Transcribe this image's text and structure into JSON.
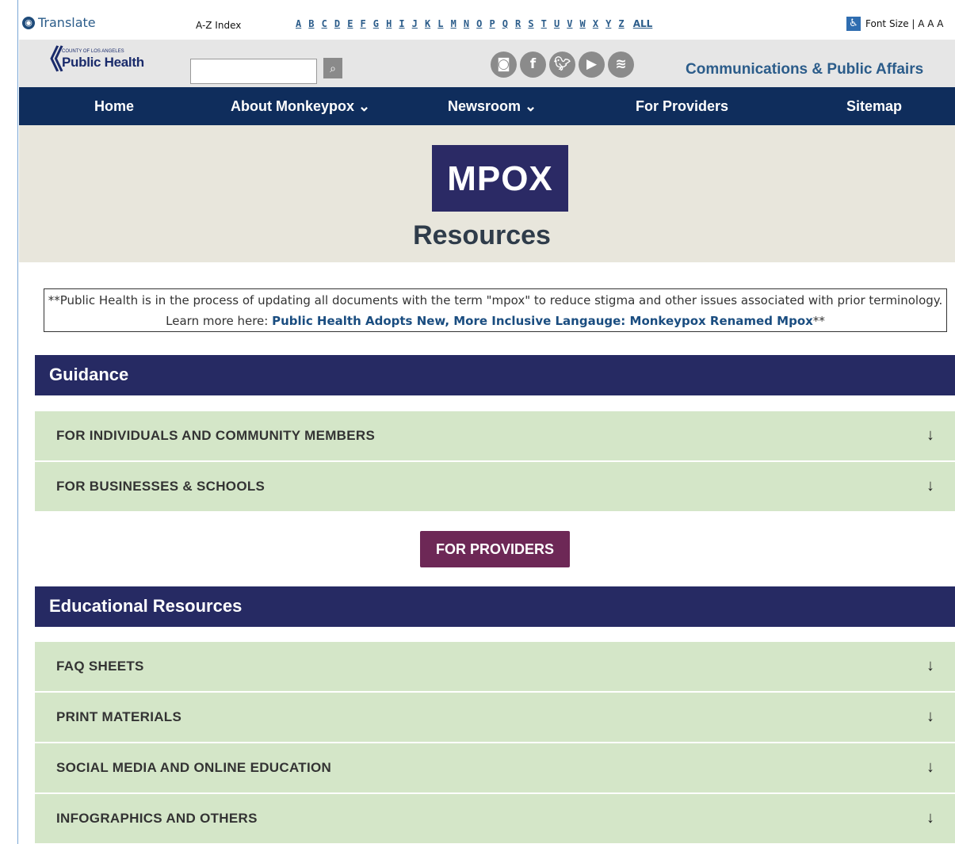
{
  "topbar": {
    "translate": "Translate",
    "az_label": "A-Z Index",
    "letters": [
      "A",
      "B",
      "C",
      "D",
      "E",
      "F",
      "G",
      "H",
      "I",
      "J",
      "K",
      "L",
      "M",
      "N",
      "O",
      "P",
      "Q",
      "R",
      "S",
      "T",
      "U",
      "V",
      "W",
      "X",
      "Y",
      "Z"
    ],
    "all": "ALL",
    "font_size": "Font Size | A A A"
  },
  "header": {
    "logo_small": "COUNTY OF LOS ANGELES",
    "logo_big": "Public Health",
    "search_placeholder": "",
    "social_icons": [
      "instagram-icon",
      "facebook-icon",
      "twitter-icon",
      "youtube-icon",
      "spotify-icon"
    ],
    "dept": "Communications & Public Affairs"
  },
  "nav": {
    "home": "Home",
    "about": "About Monkeypox",
    "newsroom": "Newsroom",
    "providers": "For Providers",
    "sitemap": "Sitemap"
  },
  "hero": {
    "badge": "MPOX",
    "title": "Resources"
  },
  "notice": {
    "text": "**Public Health is in the process of updating all documents with the term \"mpox\" to reduce stigma and other issues associated with prior terminology. Learn more here: ",
    "link": "Public Health Adopts New, More Inclusive Langauge: Monkeypox Renamed Mpox",
    "suffix": "**"
  },
  "guidance": {
    "title": "Guidance",
    "items": [
      "FOR INDIVIDUALS AND COMMUNITY MEMBERS",
      "FOR BUSINESSES & SCHOOLS"
    ]
  },
  "providers_button": "FOR PROVIDERS",
  "educational": {
    "title": "Educational Resources",
    "items": [
      "FAQ SHEETS",
      "PRINT MATERIALS",
      "SOCIAL MEDIA AND ONLINE EDUCATION",
      "INFOGRAPHICS AND OTHERS"
    ]
  },
  "colors": {
    "nav": "#0f2d5c",
    "section": "#262a63",
    "accordion": "#d4e6c8",
    "provider_button": "#6d2856"
  }
}
